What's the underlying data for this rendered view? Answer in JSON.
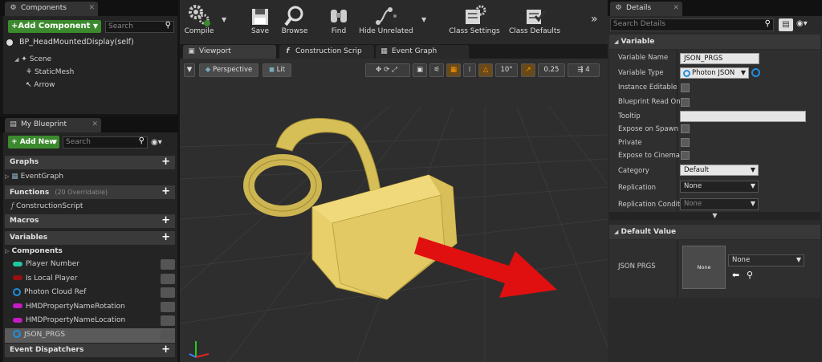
{
  "components": {
    "tab": "Components",
    "add_button": "+Add Component",
    "search_placeholder": "Search",
    "self_item": "BP_HeadMountedDisplay(self)",
    "tree": [
      "Scene",
      "StaticMesh",
      "Arrow"
    ]
  },
  "my_blueprint": {
    "tab": "My Blueprint",
    "add_new": "Add New",
    "search_placeholder": "Search",
    "graphs": "Graphs",
    "event_graph": "EventGraph",
    "functions": "Functions",
    "functions_note": "(20 Overridable)",
    "construction_script": "ConstructionScript",
    "macros": "Macros",
    "variables": "Variables",
    "components_cat": "Components",
    "vars": [
      {
        "name": "Player Number",
        "color": "#1ec8a0",
        "shape": "pill"
      },
      {
        "name": "Is Local Player",
        "color": "#9a1010",
        "shape": "pill"
      },
      {
        "name": "Photon Cloud Ref",
        "color": "#1f8ede",
        "shape": "ring"
      },
      {
        "name": "HMDPropertyNameRotation",
        "color": "#c41cc4",
        "shape": "pill"
      },
      {
        "name": "HMDPropertyNameLocation",
        "color": "#c41cc4",
        "shape": "pill"
      },
      {
        "name": "JSON_PRGS",
        "color": "#1f8ede",
        "shape": "ring"
      }
    ],
    "event_dispatchers": "Event Dispatchers"
  },
  "toolbar": {
    "compile": "Compile",
    "save": "Save",
    "browse": "Browse",
    "find": "Find",
    "hide_unrelated": "Hide Unrelated",
    "class_settings": "Class Settings",
    "class_defaults": "Class Defaults"
  },
  "editor_tabs": {
    "viewport": "Viewport",
    "construction": "Construction Scrip",
    "event_graph": "Event Graph"
  },
  "viewport": {
    "perspective": "Perspective",
    "lit": "Lit",
    "angle": "10°",
    "scale": "0.25",
    "speed": "4"
  },
  "details": {
    "tab": "Details",
    "search_placeholder": "Search Details",
    "variable_section": "Variable",
    "labels": {
      "name": "Variable Name",
      "type": "Variable Type",
      "instance_editable": "Instance Editable",
      "read_only": "Blueprint Read On",
      "tooltip": "Tooltip",
      "expose_spawn": "Expose on Spawn",
      "private": "Private",
      "expose_cinema": "Expose to Cinema",
      "category": "Category",
      "replication": "Replication",
      "replication_cond": "Replication Condit"
    },
    "values": {
      "name": "JSON_PRGS",
      "type": "Photon JSON",
      "category": "Default",
      "replication": "None",
      "replication_cond": "None"
    },
    "default_section": "Default Value",
    "default_label": "JSON PRGS",
    "thumbnail_text": "None",
    "default_combo": "None"
  },
  "colors": {
    "accent_green": "#3c8a2e",
    "headset_yellow": "#e8cf6a",
    "arrow_red": "#e01010",
    "object_ref_blue": "#1f8ede"
  }
}
